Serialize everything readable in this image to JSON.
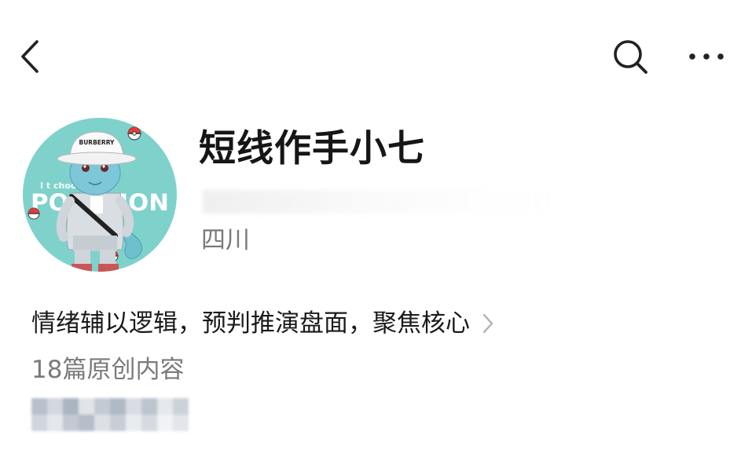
{
  "nav": {
    "back_icon": "chevron-left-icon",
    "search_icon": "search-icon",
    "more_icon": "more-horizontal-icon"
  },
  "profile": {
    "avatar": {
      "hat_text": "BURBERRY",
      "banner_text": "POKEMON",
      "tagline": "I t   choose you!",
      "background_color": "#7fd2cb"
    },
    "name": "短线作手小七",
    "location": "四川",
    "bio": "情绪辅以逻辑，预判推演盘面，聚焦核心",
    "article_count": "18篇原创内容"
  },
  "colors": {
    "text_primary": "#161616",
    "text_secondary": "#7a7a7a",
    "icon": "#222222",
    "chevron": "#b0b0b0"
  }
}
